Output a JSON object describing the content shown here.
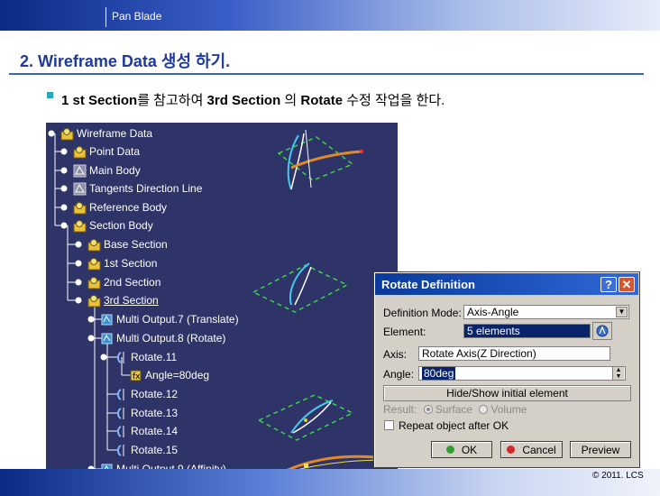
{
  "header": {
    "title": "Pan Blade"
  },
  "page_title": "2. Wireframe Data 생성 하기.",
  "bullet": {
    "part1": "1 st Section",
    "part2": "를 참고하여 ",
    "part3": "3rd Section",
    "part4": " 의 ",
    "part5": "Rotate",
    "part6": " 수정 작업을 한다."
  },
  "tree": {
    "items": [
      {
        "label": "Wireframe Data",
        "icon": "gear-folder-icon"
      },
      {
        "label": "Point Data",
        "icon": "gear-folder-icon"
      },
      {
        "label": "Main Body",
        "icon": "body-icon"
      },
      {
        "label": "Tangents Direction Line",
        "icon": "body-icon"
      },
      {
        "label": "Reference Body",
        "icon": "gear-folder-icon"
      },
      {
        "label": "Section Body",
        "icon": "gear-folder-icon"
      },
      {
        "label": "Base Section",
        "icon": "gear-folder-icon"
      },
      {
        "label": "1st Section",
        "icon": "gear-folder-icon"
      },
      {
        "label": "2nd Section",
        "icon": "gear-folder-icon"
      },
      {
        "label": "3rd Section",
        "icon": "gear-folder-icon"
      },
      {
        "label": "Multi Output.7 (Translate)",
        "icon": "multi-output-icon"
      },
      {
        "label": "Multi Output.8 (Rotate)",
        "icon": "multi-output-icon"
      },
      {
        "label": "Rotate.11",
        "icon": "rotate-icon"
      },
      {
        "label": "Angle=80deg",
        "icon": "parameter-icon"
      },
      {
        "label": "Rotate.12",
        "icon": "rotate-icon"
      },
      {
        "label": "Rotate.13",
        "icon": "rotate-icon"
      },
      {
        "label": "Rotate.14",
        "icon": "rotate-icon"
      },
      {
        "label": "Rotate.15",
        "icon": "rotate-icon"
      },
      {
        "label": "Multi Output.9 (Affinity)",
        "icon": "multi-output-icon"
      }
    ]
  },
  "dialog": {
    "title": "Rotate Definition",
    "help": "?",
    "close": "✕",
    "definition_mode_label": "Definition Mode:",
    "definition_mode_value": "Axis-Angle",
    "element_label": "Element:",
    "element_value": "5 elements",
    "axis_label": "Axis:",
    "axis_value": "Rotate Axis(Z Direction)",
    "angle_label": "Angle:",
    "angle_value": "80deg",
    "hide_show_label": "Hide/Show initial element",
    "result_label": "Result:",
    "surface_label": "Surface",
    "volume_label": "Volume",
    "repeat_label": "Repeat object after OK",
    "ok_label": "OK",
    "cancel_label": "Cancel",
    "preview_label": "Preview"
  },
  "footer": {
    "copyright": "© 2011. LCS"
  },
  "colors": {
    "accent": "#1f3a9c",
    "tree_bg": "#2e3368",
    "dialog_title": "#0a3a9b",
    "ok_green": "#2fa12f",
    "cancel_red": "#d02a2a"
  }
}
